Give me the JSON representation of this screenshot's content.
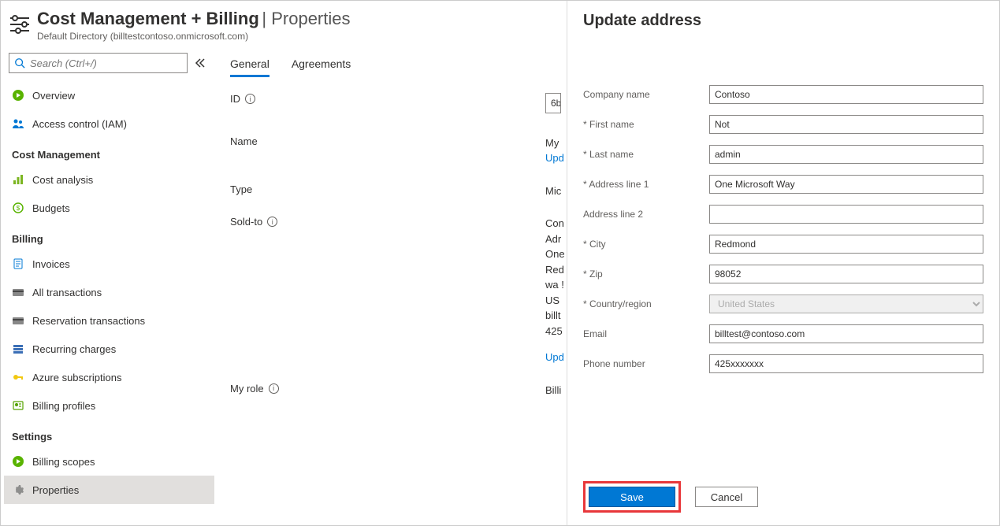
{
  "header": {
    "title_main": "Cost Management + Billing",
    "title_section": "Properties",
    "subtitle": "Default Directory (billtestcontoso.onmicrosoft.com)"
  },
  "search": {
    "placeholder": "Search (Ctrl+/)"
  },
  "nav": {
    "top": [
      {
        "id": "overview",
        "label": "Overview",
        "icon": "circle-play",
        "color": "#59b300"
      },
      {
        "id": "iam",
        "label": "Access control (IAM)",
        "icon": "people",
        "color": "#0078d4"
      }
    ],
    "cost_mgmt_label": "Cost Management",
    "cost_mgmt": [
      {
        "id": "cost-analysis",
        "label": "Cost analysis",
        "icon": "chart",
        "color": "#7bb520"
      },
      {
        "id": "budgets",
        "label": "Budgets",
        "icon": "money",
        "color": "#59b300"
      }
    ],
    "billing_label": "Billing",
    "billing": [
      {
        "id": "invoices",
        "label": "Invoices",
        "icon": "doc",
        "color": "#0078d4"
      },
      {
        "id": "all-transactions",
        "label": "All transactions",
        "icon": "card",
        "color": "#6b6b6b"
      },
      {
        "id": "reservation-transactions",
        "label": "Reservation transactions",
        "icon": "card2",
        "color": "#6b6b6b"
      },
      {
        "id": "recurring-charges",
        "label": "Recurring charges",
        "icon": "rows",
        "color": "#3b6fb6"
      },
      {
        "id": "azure-subscriptions",
        "label": "Azure subscriptions",
        "icon": "key",
        "color": "#f2c811"
      },
      {
        "id": "billing-profiles",
        "label": "Billing profiles",
        "icon": "profile",
        "color": "#57a300"
      }
    ],
    "settings_label": "Settings",
    "settings": [
      {
        "id": "billing-scopes",
        "label": "Billing scopes",
        "icon": "scope",
        "color": "#59b300"
      },
      {
        "id": "properties",
        "label": "Properties",
        "icon": "gear",
        "color": "#6b6b6b",
        "selected": true
      }
    ]
  },
  "tabs": {
    "general": "General",
    "agreements": "Agreements"
  },
  "props": {
    "id_label": "ID",
    "id_value": "6b",
    "name_label": "Name",
    "name_value": "My",
    "name_update": "Upd",
    "type_label": "Type",
    "type_value": "Mic",
    "soldto_label": "Sold-to",
    "soldto_lines": [
      "Con",
      "Adr",
      "One",
      "Red",
      "wa !",
      "US",
      "billt",
      "425"
    ],
    "soldto_update": "Upd",
    "myrole_label": "My role",
    "myrole_value": "Billi"
  },
  "panel": {
    "title": "Update address",
    "fields": {
      "company": {
        "label": "Company name",
        "value": "Contoso"
      },
      "first_name": {
        "label": "* First name",
        "value": "Not"
      },
      "last_name": {
        "label": "* Last name",
        "value": "admin"
      },
      "addr1": {
        "label": "* Address line 1",
        "value": "One Microsoft Way"
      },
      "addr2": {
        "label": "Address line 2",
        "value": ""
      },
      "city": {
        "label": "* City",
        "value": "Redmond"
      },
      "zip": {
        "label": "* Zip",
        "value": "98052"
      },
      "country": {
        "label": "* Country/region",
        "value": "United States"
      },
      "email": {
        "label": "Email",
        "value": "billtest@contoso.com"
      },
      "phone": {
        "label": "Phone number",
        "value": "425xxxxxxx"
      }
    },
    "save": "Save",
    "cancel": "Cancel"
  }
}
